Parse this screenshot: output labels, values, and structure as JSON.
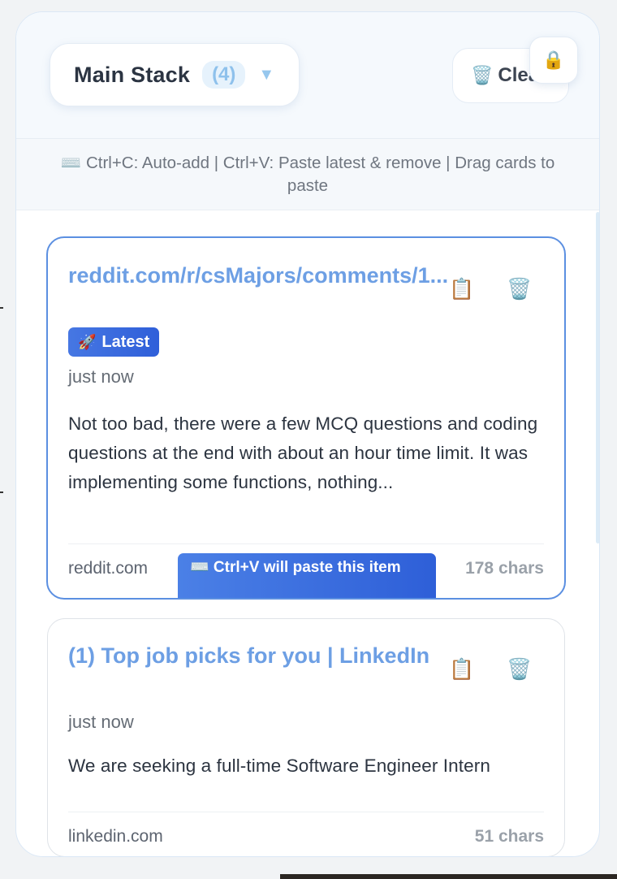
{
  "header": {
    "stack_name": "Main Stack",
    "stack_count": "(4)",
    "dropdown_arrow": "▼",
    "clear_label": "Clear",
    "clear_icon_glyph": "🗑️",
    "lock_icon_glyph": "🔒"
  },
  "hint": "⌨️ Ctrl+C: Auto-add | Ctrl+V: Paste latest & remove | Drag cards to paste",
  "cards": [
    {
      "title": "reddit.com/r/csMajors/comments/1...",
      "badge": "Latest",
      "badge_icon": "🚀",
      "time": "just now",
      "preview": "Not too bad, there were a few MCQ questions and coding questions at the end with about an hour time limit. It was implementing some functions, nothing...",
      "domain": "reddit.com",
      "paste_hint": "⌨️ Ctrl+V will paste this item",
      "chars": "178 chars",
      "copy_icon": "📋",
      "delete_icon": "🗑️"
    },
    {
      "title": "(1) Top job picks for you | LinkedIn",
      "time": "just now",
      "preview": "We are seeking a full-time Software Engineer Intern",
      "domain": "linkedin.com",
      "chars": "51 chars",
      "copy_icon": "📋",
      "delete_icon": "🗑️"
    }
  ],
  "colors": {
    "accent": "#5b8fe1",
    "title_link": "#6d9fe4",
    "badge_bg": "#3a6ade",
    "panel_border": "#dbe8f6"
  }
}
